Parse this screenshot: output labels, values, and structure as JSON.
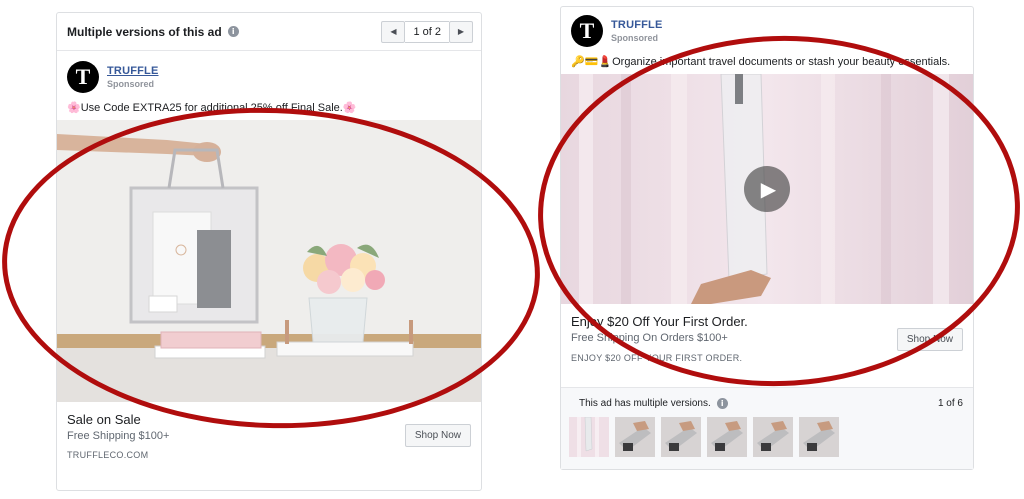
{
  "left_ad": {
    "versions_bar": {
      "title": "Multiple versions of this ad",
      "info_glyph": "i",
      "prev_glyph": "◀",
      "next_glyph": "▶",
      "page_indicator": "1 of 2"
    },
    "brand_logo_letter": "T",
    "brand_name": "TRUFFLE",
    "sponsored": "Sponsored",
    "text_emoji_start": "🌸",
    "text": "Use Code EXTRA25 for additional 25% off Final Sale.",
    "text_emoji_end": "🌸",
    "headline": "Sale on Sale",
    "description": "Free Shipping $100+",
    "domain": "TRUFFLECO.COM",
    "cta_label": "Shop Now"
  },
  "right_ad": {
    "brand_logo_letter": "T",
    "brand_name": "TRUFFLE",
    "sponsored": "Sponsored",
    "text_emoji": "🔑💳💄",
    "text": "Organize important travel documents or stash your beauty essentials.",
    "play_glyph": "▶",
    "headline": "Enjoy $20 Off Your First Order.",
    "description": "Free Shipping On Orders $100+",
    "caption": "ENJOY $20 OFF YOUR FIRST ORDER.",
    "cta_label": "Shop Now",
    "versions_footer": {
      "label": "This ad has multiple versions.",
      "info_glyph": "i",
      "count": "1 of 6",
      "thumbnail_count": 6,
      "active_index": 0
    }
  },
  "colors": {
    "brand_link": "#365899",
    "annotation_red": "#b00d0d",
    "active_thumb": "#4267b2"
  }
}
